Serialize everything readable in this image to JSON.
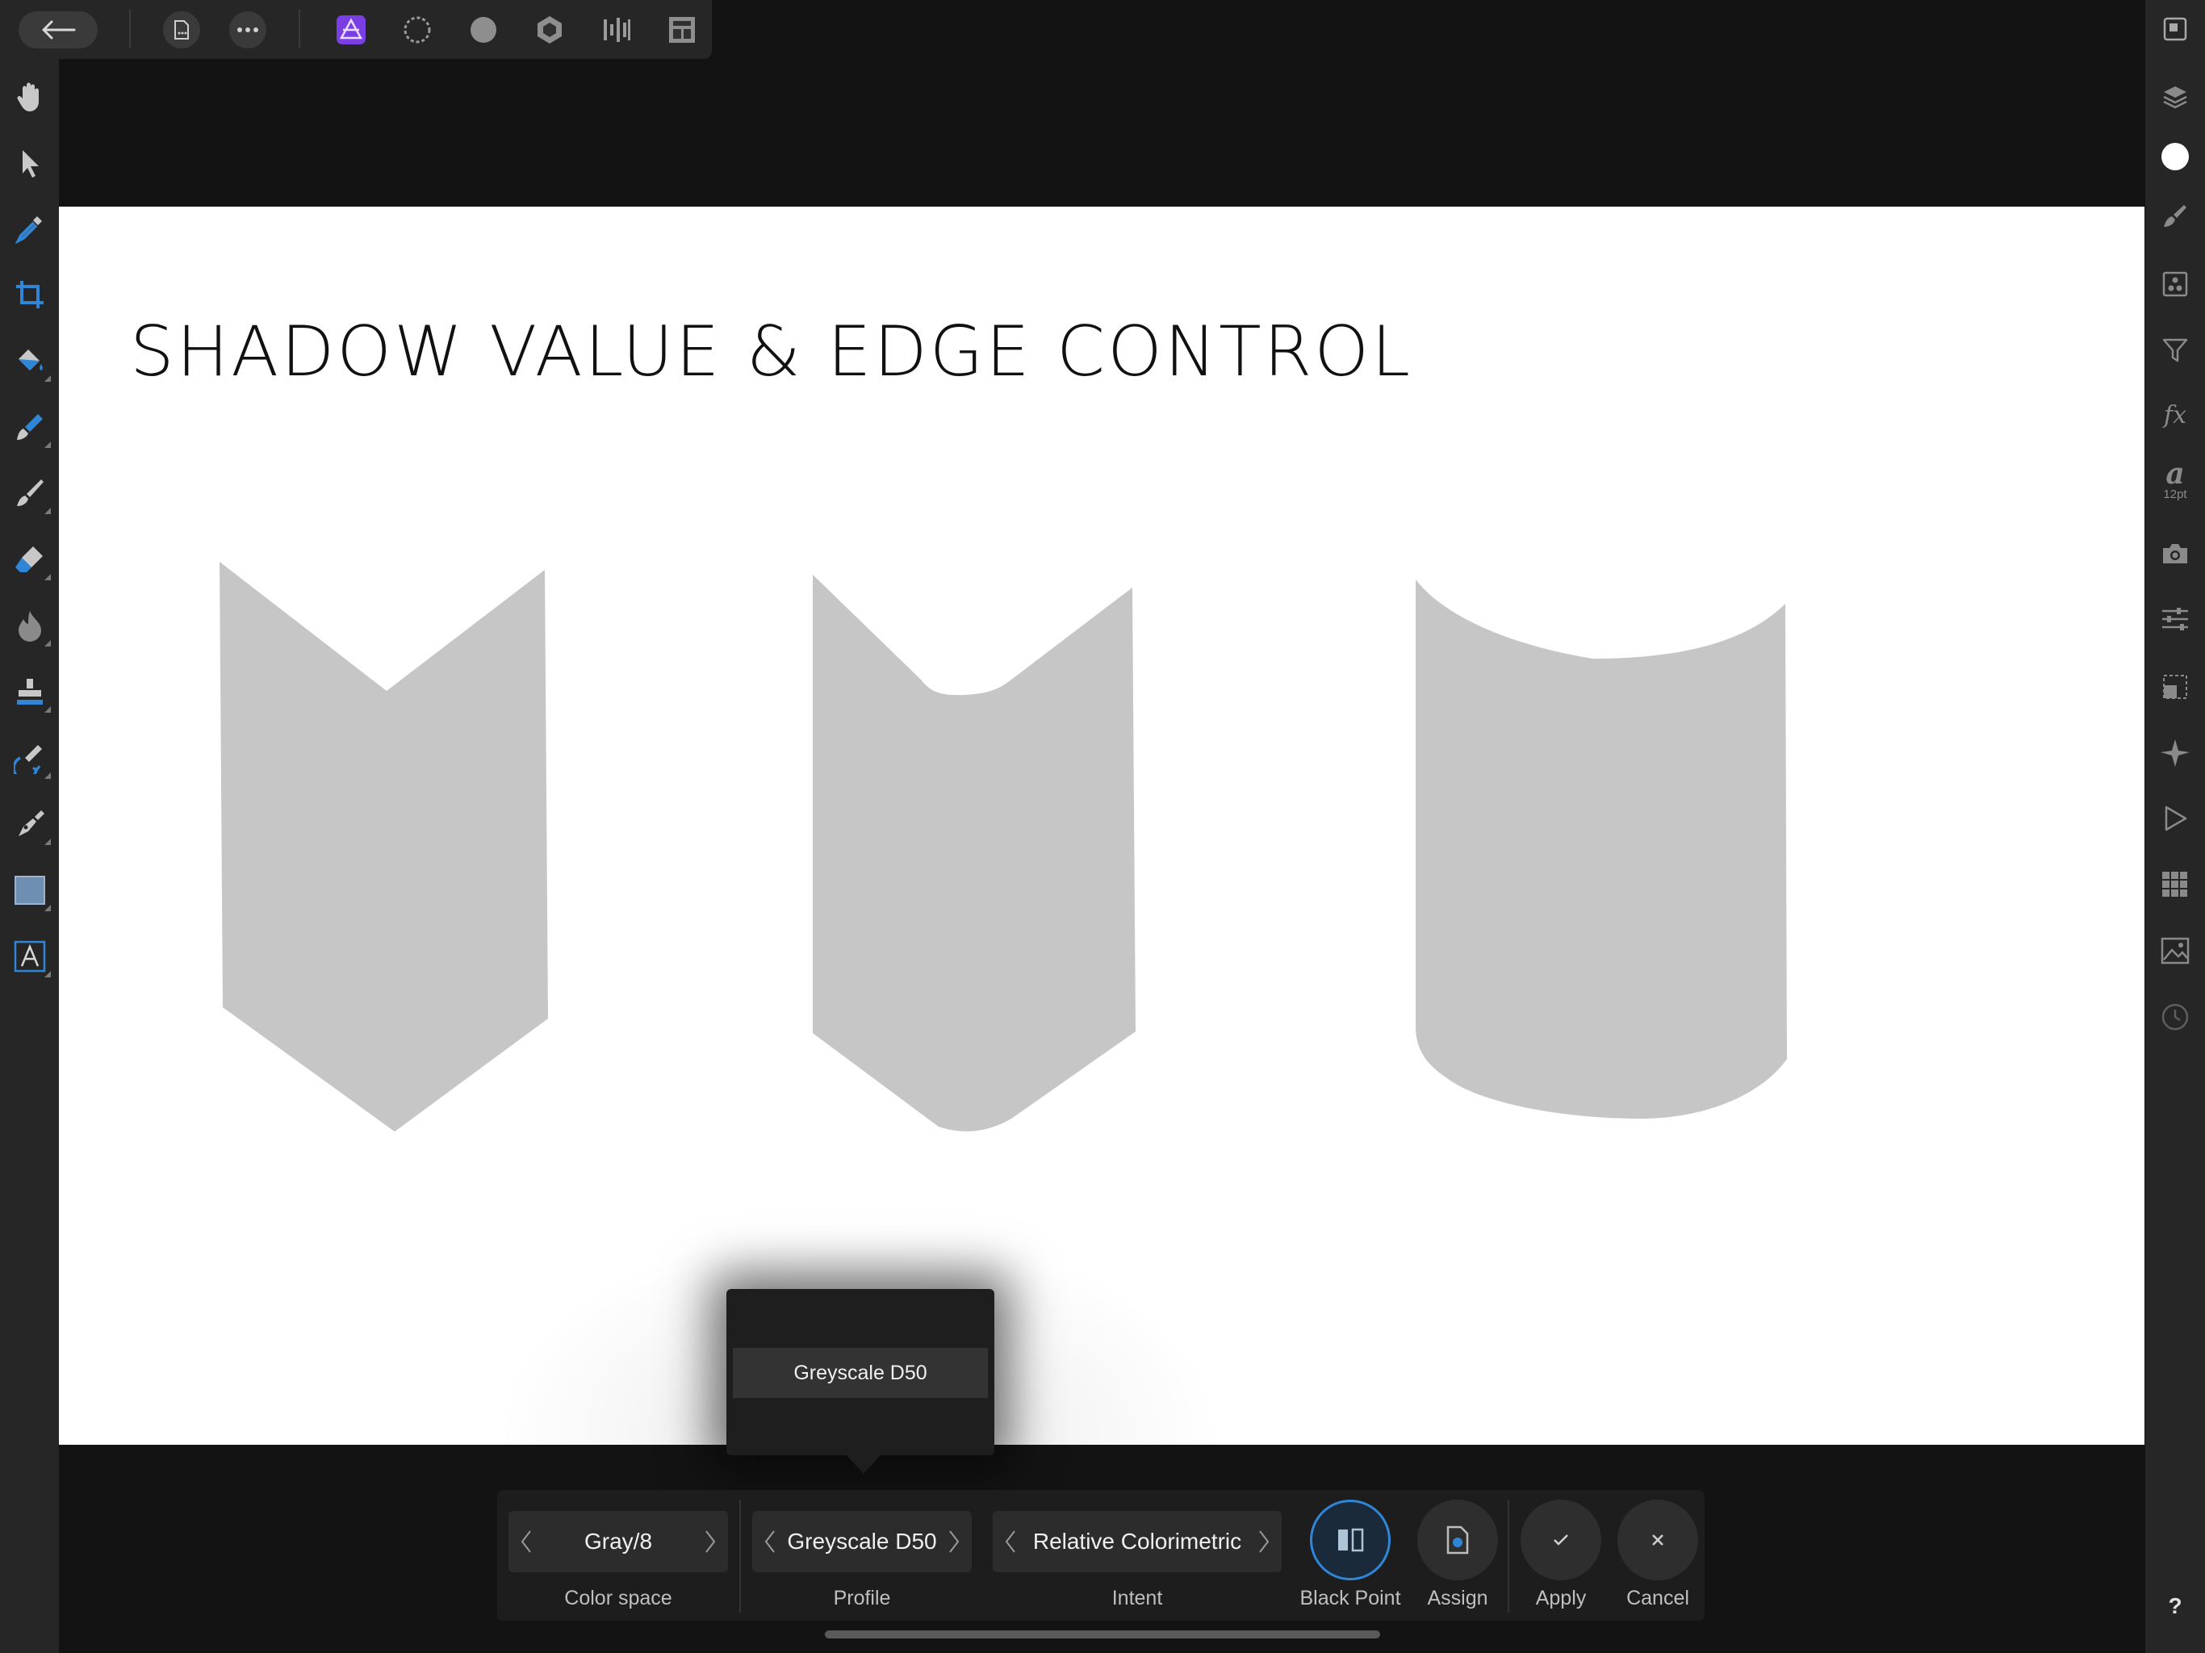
{
  "document": {
    "title": "SHADOW VALUE & EDGE CONTROL"
  },
  "right_studio": {
    "font_size": "12pt"
  },
  "popover": {
    "selected_item": "Greyscale D50"
  },
  "convert_panel": {
    "color_space": {
      "value": "Gray/8",
      "label": "Color space"
    },
    "profile": {
      "value": "Greyscale D50",
      "label": "Profile"
    },
    "intent": {
      "value": "Relative Colorimetric",
      "label": "Intent"
    },
    "black_point": {
      "label": "Black Point"
    },
    "assign": {
      "label": "Assign"
    },
    "apply": {
      "label": "Apply"
    },
    "cancel": {
      "label": "Cancel"
    }
  },
  "help": {
    "label": "?"
  },
  "colors": {
    "accent": "#2f86d6",
    "shape_fill": "#c6c6c6",
    "persona_purple": "#7a3fe4"
  },
  "icons": {
    "top": [
      "back-arrow-icon",
      "document-icon",
      "more-icon",
      "photo-persona-icon",
      "liquify-persona-icon",
      "develop-persona-icon",
      "tone-mapping-persona-icon",
      "export-persona-icon",
      "panorama-persona-icon"
    ],
    "left": [
      "hand-icon",
      "move-icon",
      "color-picker-icon",
      "crop-icon",
      "flood-fill-icon",
      "selection-brush-icon",
      "paint-brush-icon",
      "erase-brush-icon",
      "dodge-icon",
      "clone-icon",
      "healing-icon",
      "pen-icon",
      "rectangle-icon",
      "text-icon"
    ]
  }
}
